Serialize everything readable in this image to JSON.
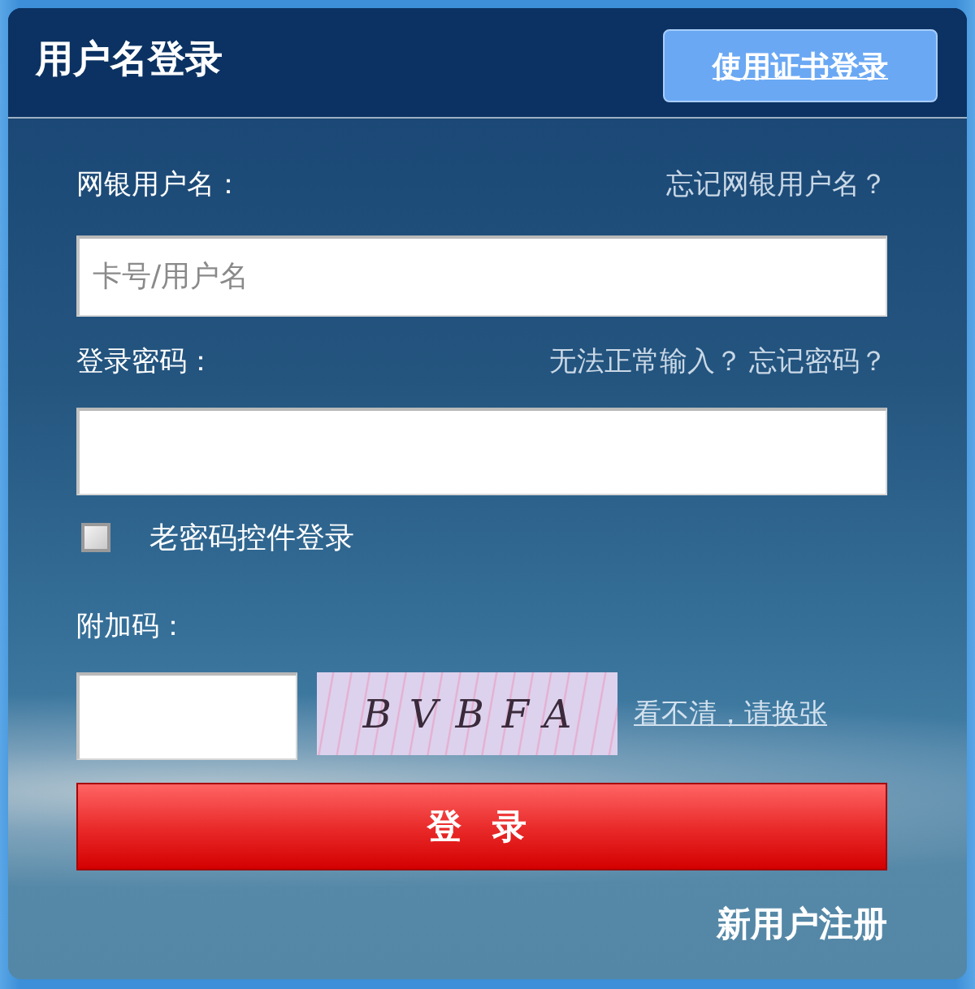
{
  "header": {
    "title": "用户名登录",
    "cert_login_button": "使用证书登录"
  },
  "fields": [
    {
      "label": "网银用户名：",
      "links": [
        "忘记网银用户名？"
      ],
      "placeholder": "卡号/用户名"
    },
    {
      "label": "登录密码：",
      "links": [
        "无法正常输入？",
        "忘记密码？"
      ]
    }
  ],
  "old_control_checkbox": {
    "label": "老密码控件登录",
    "checked": false
  },
  "captcha": {
    "label": "附加码：",
    "code": "BVBFA",
    "refresh_link": "看不清，请换张"
  },
  "login_button": "登 录",
  "register_link": "新用户注册"
}
